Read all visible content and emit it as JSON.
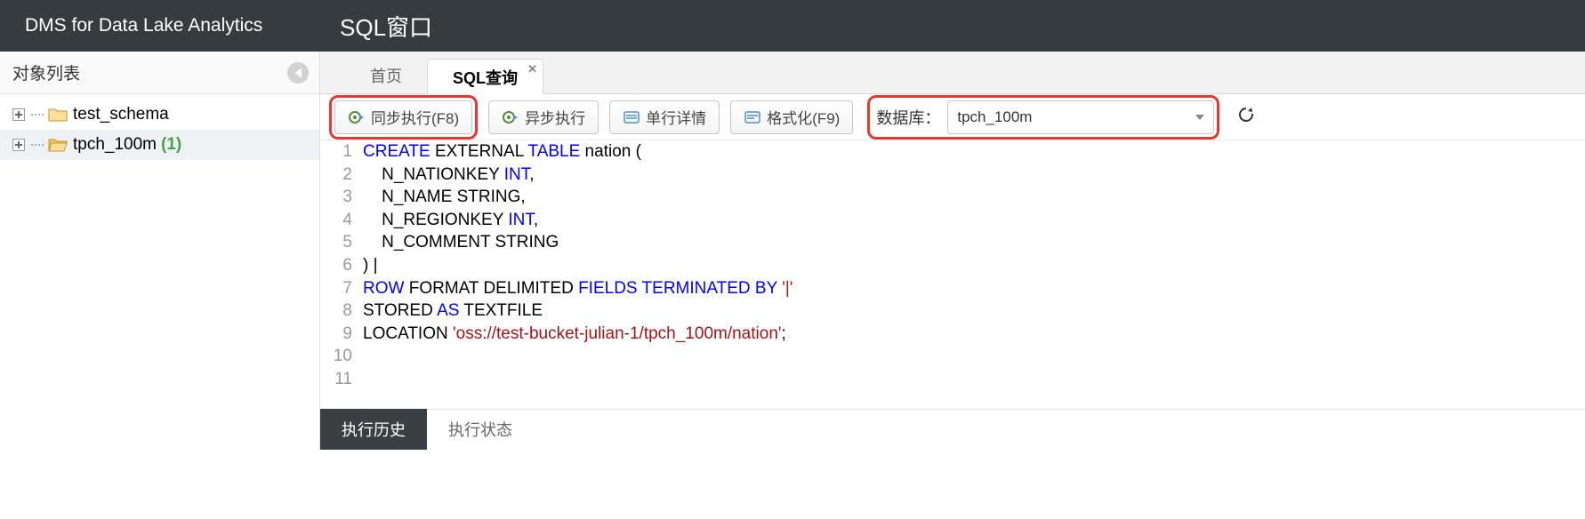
{
  "header": {
    "brand": "DMS for Data Lake Analytics",
    "title": "SQL窗口"
  },
  "sidebar": {
    "title": "对象列表",
    "items": [
      {
        "label": "test_schema",
        "selected": false,
        "open": false,
        "count": null
      },
      {
        "label": "tpch_100m",
        "selected": true,
        "open": true,
        "count": "(1)"
      }
    ]
  },
  "tabs": [
    {
      "label": "首页",
      "active": false,
      "closable": false
    },
    {
      "label": "SQL查询",
      "active": true,
      "closable": true
    }
  ],
  "toolbar": {
    "sync_run": "同步执行(F8)",
    "async_run": "异步执行",
    "row_detail": "单行详情",
    "format": "格式化(F9)",
    "db_label": "数据库：",
    "db_value": "tpch_100m"
  },
  "sql": {
    "lines": [
      {
        "n": 1,
        "segments": [
          {
            "t": "CREATE",
            "c": "kw"
          },
          {
            "t": " EXTERNAL ",
            "c": "dark"
          },
          {
            "t": "TABLE",
            "c": "kw"
          },
          {
            "t": " nation (",
            "c": "dark"
          }
        ]
      },
      {
        "n": 2,
        "segments": [
          {
            "t": "    N_NATIONKEY ",
            "c": "dark"
          },
          {
            "t": "INT",
            "c": "kw"
          },
          {
            "t": ",",
            "c": "dark"
          }
        ]
      },
      {
        "n": 3,
        "segments": [
          {
            "t": "    N_NAME STRING,",
            "c": "dark"
          }
        ]
      },
      {
        "n": 4,
        "segments": [
          {
            "t": "    N_REGIONKEY ",
            "c": "dark"
          },
          {
            "t": "INT",
            "c": "kw"
          },
          {
            "t": ",",
            "c": "dark"
          }
        ]
      },
      {
        "n": 5,
        "segments": [
          {
            "t": "    N_COMMENT STRING",
            "c": "dark"
          }
        ]
      },
      {
        "n": 6,
        "segments": [
          {
            "t": ") |",
            "c": "dark"
          }
        ]
      },
      {
        "n": 7,
        "segments": [
          {
            "t": "ROW",
            "c": "kw"
          },
          {
            "t": " FORMAT DELIMITED ",
            "c": "dark"
          },
          {
            "t": "FIELDS",
            "c": "kw"
          },
          {
            "t": " ",
            "c": "dark"
          },
          {
            "t": "TERMINATED",
            "c": "kw"
          },
          {
            "t": " ",
            "c": "dark"
          },
          {
            "t": "BY",
            "c": "kw"
          },
          {
            "t": " ",
            "c": "dark"
          },
          {
            "t": "'|'",
            "c": "str"
          }
        ]
      },
      {
        "n": 8,
        "segments": [
          {
            "t": "STORED ",
            "c": "dark"
          },
          {
            "t": "AS",
            "c": "kw"
          },
          {
            "t": " TEXTFILE",
            "c": "dark"
          }
        ]
      },
      {
        "n": 9,
        "segments": [
          {
            "t": "LOCATION ",
            "c": "dark"
          },
          {
            "t": "'oss://test-bucket-julian-1/tpch_100m/nation'",
            "c": "str"
          },
          {
            "t": ";",
            "c": "dark"
          }
        ]
      },
      {
        "n": 10,
        "segments": []
      },
      {
        "n": 11,
        "segments": []
      }
    ]
  },
  "bottom_tabs": [
    {
      "label": "执行历史",
      "active": true
    },
    {
      "label": "执行状态",
      "active": false
    }
  ]
}
